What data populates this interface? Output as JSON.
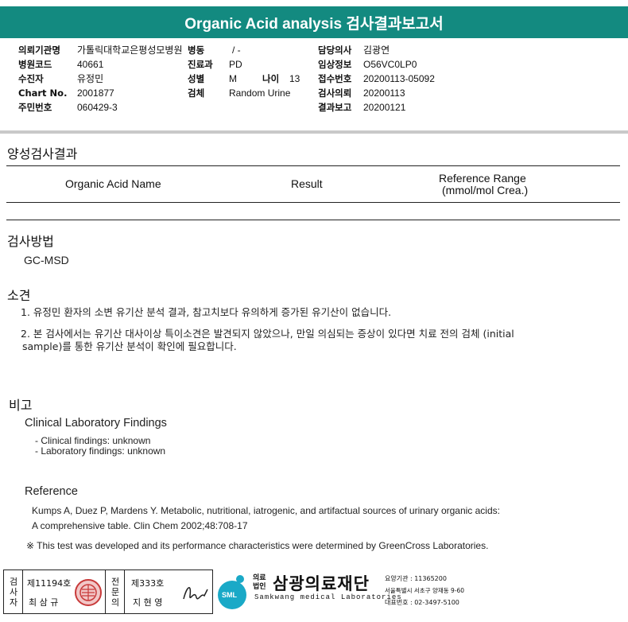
{
  "title": "Organic Acid analysis 검사결과보고서",
  "header_info": {
    "left": [
      {
        "label": "의뢰기관명",
        "value": "가톨릭대학교은평성모병원"
      },
      {
        "label": "병원코드",
        "value": "40661"
      },
      {
        "label": "수진자",
        "value": "유정민"
      },
      {
        "label": "Chart No.",
        "value": "2001877"
      },
      {
        "label": "주민번호",
        "value": "060429-3"
      }
    ],
    "mid": [
      {
        "label": "병동",
        "value": "/ -"
      },
      {
        "label": "진료과",
        "value": "PD"
      },
      {
        "label": "성별",
        "value": "M"
      },
      {
        "label": "검체",
        "value": "Random Urine"
      }
    ],
    "age": {
      "label": "나이",
      "value": "13"
    },
    "right": [
      {
        "label": "담당의사",
        "value": "김광연"
      },
      {
        "label": "임상정보",
        "value": "O56VC0LP0"
      },
      {
        "label": "접수번호",
        "value": "20200113-05092"
      },
      {
        "label": "검사의뢰",
        "value": "20200113"
      },
      {
        "label": "결과보고",
        "value": "20200121"
      }
    ]
  },
  "positive_section": {
    "heading": "양성검사결과",
    "columns": [
      "Organic Acid Name",
      "Result",
      "Reference Range",
      "(mmol/mol Crea.)"
    ]
  },
  "method_section": {
    "heading": "검사방법",
    "text": "GC-MSD"
  },
  "findings_section": {
    "heading": "소견",
    "item1": "1. 유정민 환자의 소변 유기산 분석 결과, 참고치보다 유의하게 증가된 유기산이 없습니다.",
    "item2_line1": "2. 본 검사에서는 유기산 대사이상 특이소견은 발견되지 않았으나, 만일 의심되는 증상이 있다면 치료 전의 검체 (initial",
    "item2_line2": "sample)를 통한 유기산 분석이 확인에 필요합니다."
  },
  "remarks_section": {
    "heading": "비고",
    "clinical_title": "Clinical Laboratory Findings",
    "clinical_item1": "- Clinical findings: unknown",
    "clinical_item2": "- Laboratory findings: unknown",
    "reference_title": "Reference",
    "reference_line1": "Kumps A, Duez P, Mardens Y. Metabolic, nutritional, iatrogenic, and artifactual sources of urinary organic acids:",
    "reference_line2": "A comprehensive table. Clin Chem 2002;48:708-17",
    "note": "※ This test was developed and its performance characteristics were determined by GreenCross Laboratories."
  },
  "footer": {
    "inspector_label": "검사자",
    "inspector_no": "제11194호",
    "inspector_name": "최 삼 규",
    "specialist_label": "전문의",
    "specialist_no": "제333호",
    "specialist_name": "지 현 영",
    "org_badge": "SML",
    "org_legal": "의료법인",
    "org_name": "삼광의료재단",
    "org_en": "Samkwang medical Laboratories",
    "org_code": "요양기관 : 11365200",
    "org_address": "서울특별시 서초구 양재동 9-60",
    "org_phone": "대표번호 : 02-3497-5100",
    "colors": {
      "title_bar": "#138a80",
      "badge": "#1aa9c7",
      "seal": "#c83a3a"
    }
  }
}
